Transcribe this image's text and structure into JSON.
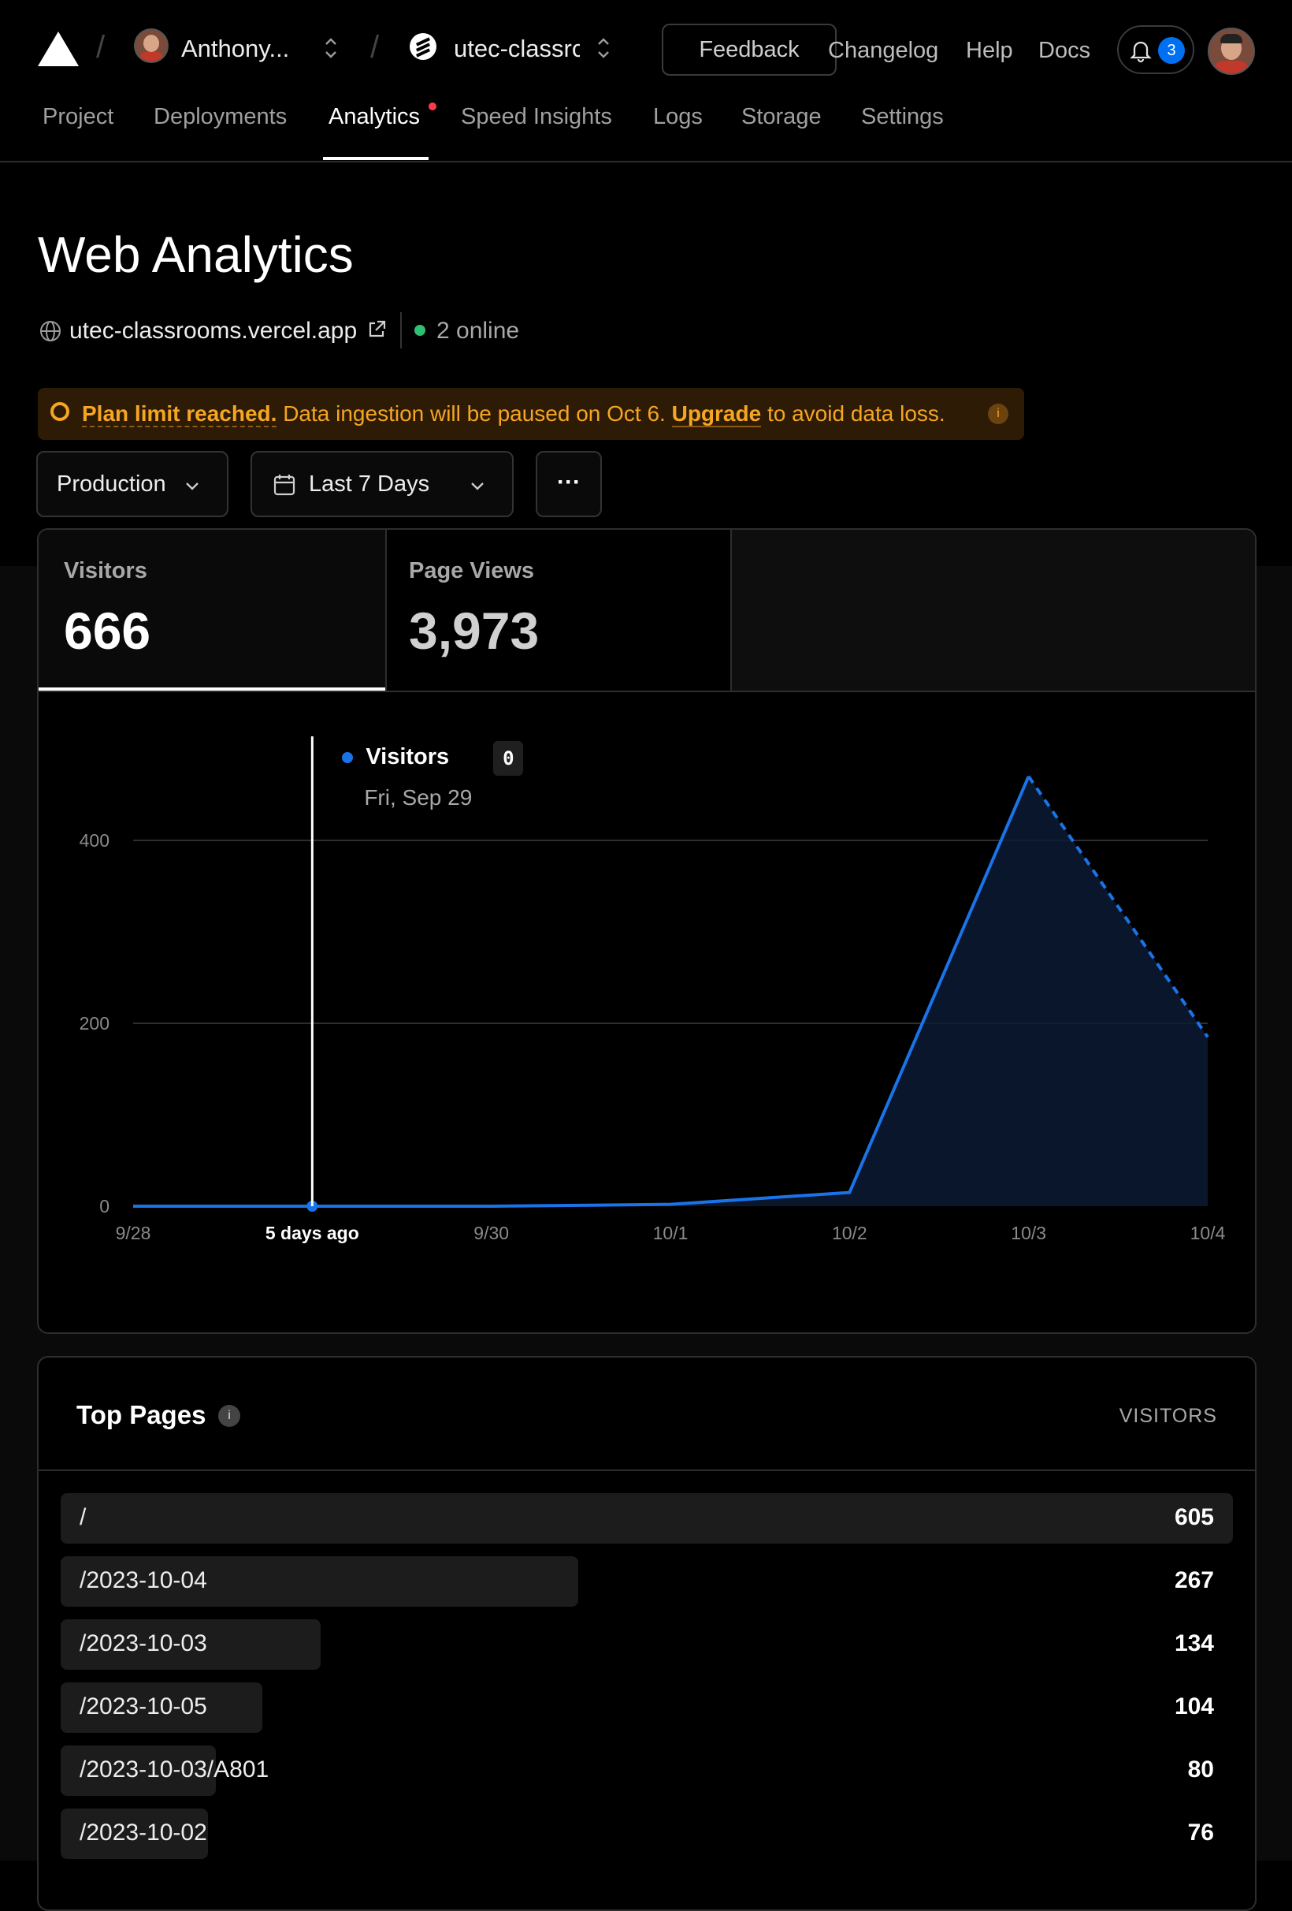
{
  "header": {
    "team_name": "Anthony...",
    "project_name": "utec-classrc",
    "feedback_label": "Feedback",
    "links": [
      "Changelog",
      "Help",
      "Docs"
    ],
    "notification_count": "3"
  },
  "tabs": [
    {
      "label": "Project"
    },
    {
      "label": "Deployments"
    },
    {
      "label": "Analytics"
    },
    {
      "label": "Speed Insights"
    },
    {
      "label": "Logs"
    },
    {
      "label": "Storage"
    },
    {
      "label": "Settings"
    }
  ],
  "page": {
    "title": "Web Analytics",
    "domain": "utec-classrooms.vercel.app",
    "online": "2 online"
  },
  "banner": {
    "strong": "Plan limit reached.",
    "text": "Data ingestion will be paused on Oct 6.",
    "link": "Upgrade",
    "suffix": "to avoid data loss.",
    "color": "#f5a623"
  },
  "filters": {
    "environment": "Production",
    "range": "Last 7 Days",
    "more": "···"
  },
  "metrics": [
    {
      "label": "Visitors",
      "value": "666"
    },
    {
      "label": "Page Views",
      "value": "3,973"
    }
  ],
  "chart_data": {
    "type": "area",
    "series": [
      {
        "name": "Visitors",
        "color": "#1a73e8",
        "x": [
          "9/28",
          "9/29",
          "9/30",
          "10/1",
          "10/2",
          "10/3",
          "10/4"
        ],
        "values": [
          0,
          0,
          0,
          2,
          15,
          470,
          185
        ],
        "dashed_from_index": 5
      }
    ],
    "xticks": [
      "9/28",
      "5 days ago",
      "9/30",
      "10/1",
      "10/2",
      "10/3",
      "10/4"
    ],
    "yticks": [
      0,
      200,
      400
    ],
    "ylim": [
      0,
      500
    ],
    "grid": true,
    "tooltip": {
      "series": "Visitors",
      "value": "0",
      "date": "Fri, Sep 29",
      "index": 1
    }
  },
  "top_pages": {
    "title": "Top Pages",
    "column": "VISITORS",
    "rows": [
      {
        "path": "/",
        "visitors": 605
      },
      {
        "path": "/2023-10-04",
        "visitors": 267
      },
      {
        "path": "/2023-10-03",
        "visitors": 134
      },
      {
        "path": "/2023-10-05",
        "visitors": 104
      },
      {
        "path": "/2023-10-03/A801",
        "visitors": 80
      },
      {
        "path": "/2023-10-02",
        "visitors": 76
      }
    ]
  },
  "colors": {
    "accent": "#0070f3",
    "online": "#2fbf71",
    "warning": "#f5a623"
  }
}
